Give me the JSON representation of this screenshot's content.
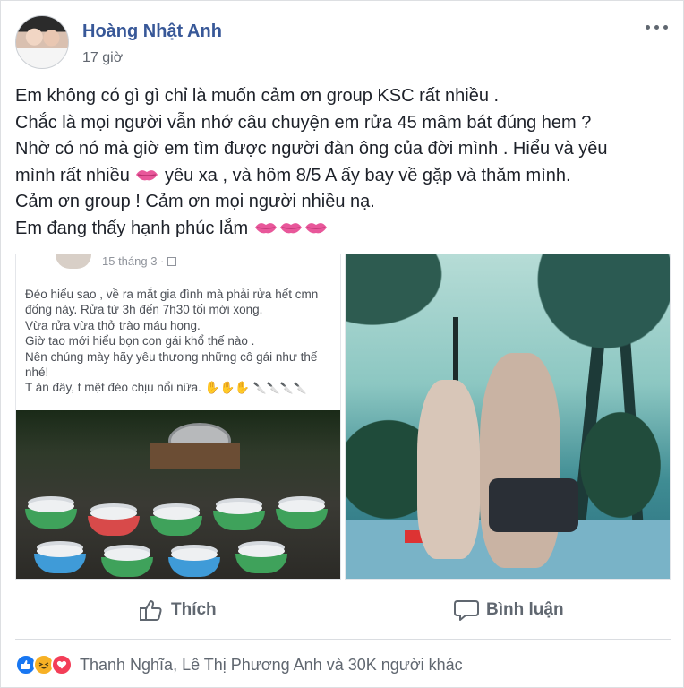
{
  "post": {
    "author": "Hoàng Nhật Anh",
    "time": "17 giờ",
    "lines": [
      "Em không có gì gì chỉ là muốn cảm ơn group KSC rất nhiều .",
      "Chắc là mọi người vẫn nhớ câu chuyện em rửa 45 mâm bát đúng hem ?",
      "Nhờ có nó mà giờ em tìm được người đàn ông của đời mình . Hiểu và yêu",
      "mình rất nhiều",
      "yêu xa , và hôm 8/5 A ấy bay về gặp và thăm mình.",
      "Cảm ơn group ! Cảm ơn mọi người nhiều nạ.",
      "Em đang thấy hạnh phúc lắm"
    ]
  },
  "screenshot_post": {
    "date": "15 tháng 3 · ",
    "lines": [
      "Đéo hiểu sao , về ra mắt gia đình mà phải rửa hết cmn",
      "đống này. Rửa từ 3h đến 7h30 tối mới xong.",
      "Vừa rửa vừa thở trào máu họng.",
      "Giờ tao mới hiểu bọn con gái khổ thế nào .",
      "Nên chúng mày hãy yêu thương những cô gái như thế",
      "nhé!",
      "T ăn đây, t mệt đéo chịu nổi nữa."
    ]
  },
  "actions": {
    "like": "Thích",
    "comment": "Bình luận"
  },
  "reactions": {
    "summary": "Thanh Nghĩa, Lê Thị Phương Anh và 30K người khác",
    "colors": {
      "like": "#1877f2",
      "haha": "#f7b125",
      "love": "#f33e58"
    }
  }
}
